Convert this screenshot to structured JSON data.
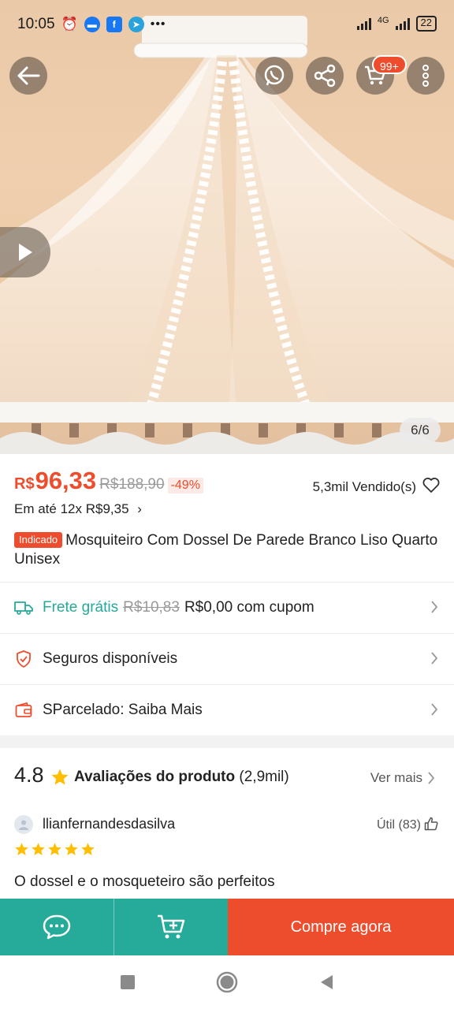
{
  "status_bar": {
    "time": "10:05",
    "network": "4G",
    "battery": "22"
  },
  "gallery": {
    "counter": "6/6"
  },
  "header": {
    "cart_badge": "99+"
  },
  "product": {
    "currency": "R$",
    "price": "96,33",
    "old_price": "R$188,90",
    "discount": "-49%",
    "sold": "5,3mil Vendido(s)",
    "installment_prefix": "Em até",
    "installment_value": "12x R$9,35",
    "badge": "Indicado",
    "title": "Mosquiteiro Com Dossel De Parede Branco Liso Quarto Unisex"
  },
  "shipping": {
    "label": "Frete grátis",
    "old_price": "R$10,83",
    "new_price": "R$0,00 com cupom"
  },
  "insurance": {
    "label": "Seguros disponíveis"
  },
  "installments_row": {
    "label": "SParcelado: Saiba Mais"
  },
  "reviews": {
    "rating": "4.8",
    "title": "Avaliações do produto",
    "count": "(2,9mil)",
    "see_more": "Ver mais",
    "reviewer": "llianfernandesdasilva",
    "useful": "Útil (83)",
    "stars": 5,
    "text": "O dossel e o mosqueteiro são perfeitos"
  },
  "actions": {
    "buy_now": "Compre agora"
  },
  "colors": {
    "accent": "#ee4d2d",
    "teal": "#26aa99",
    "star": "#ffbf00"
  }
}
